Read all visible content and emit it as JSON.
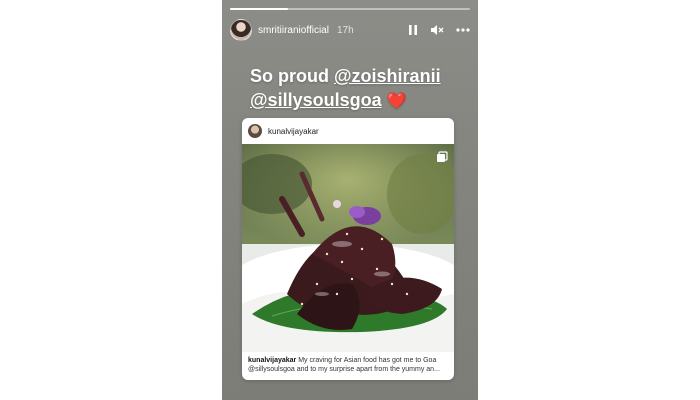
{
  "story": {
    "progress": 0.24,
    "username": "smritiiraniofficial",
    "time": "17h",
    "icons": {
      "pause": "pause-icon",
      "mute": "mute-icon",
      "more": "more-icon"
    },
    "caption": {
      "line1_prefix": "So proud ",
      "mention1": "@zoishiranii",
      "mention2": "@sillysoulsgoa",
      "emoji": "❤️"
    }
  },
  "post": {
    "username": "kunalvijayakar",
    "caption_user": "kunalvijayakar",
    "caption_text": " My craving for Asian food has got me to Goa @sillysoulsgoa and to my surprise apart from the yummy an..."
  },
  "colors": {
    "story_background": "#84857f",
    "heart": "#e02a37",
    "leaf": "#2f7a2a",
    "food": "#3a1a1c"
  }
}
